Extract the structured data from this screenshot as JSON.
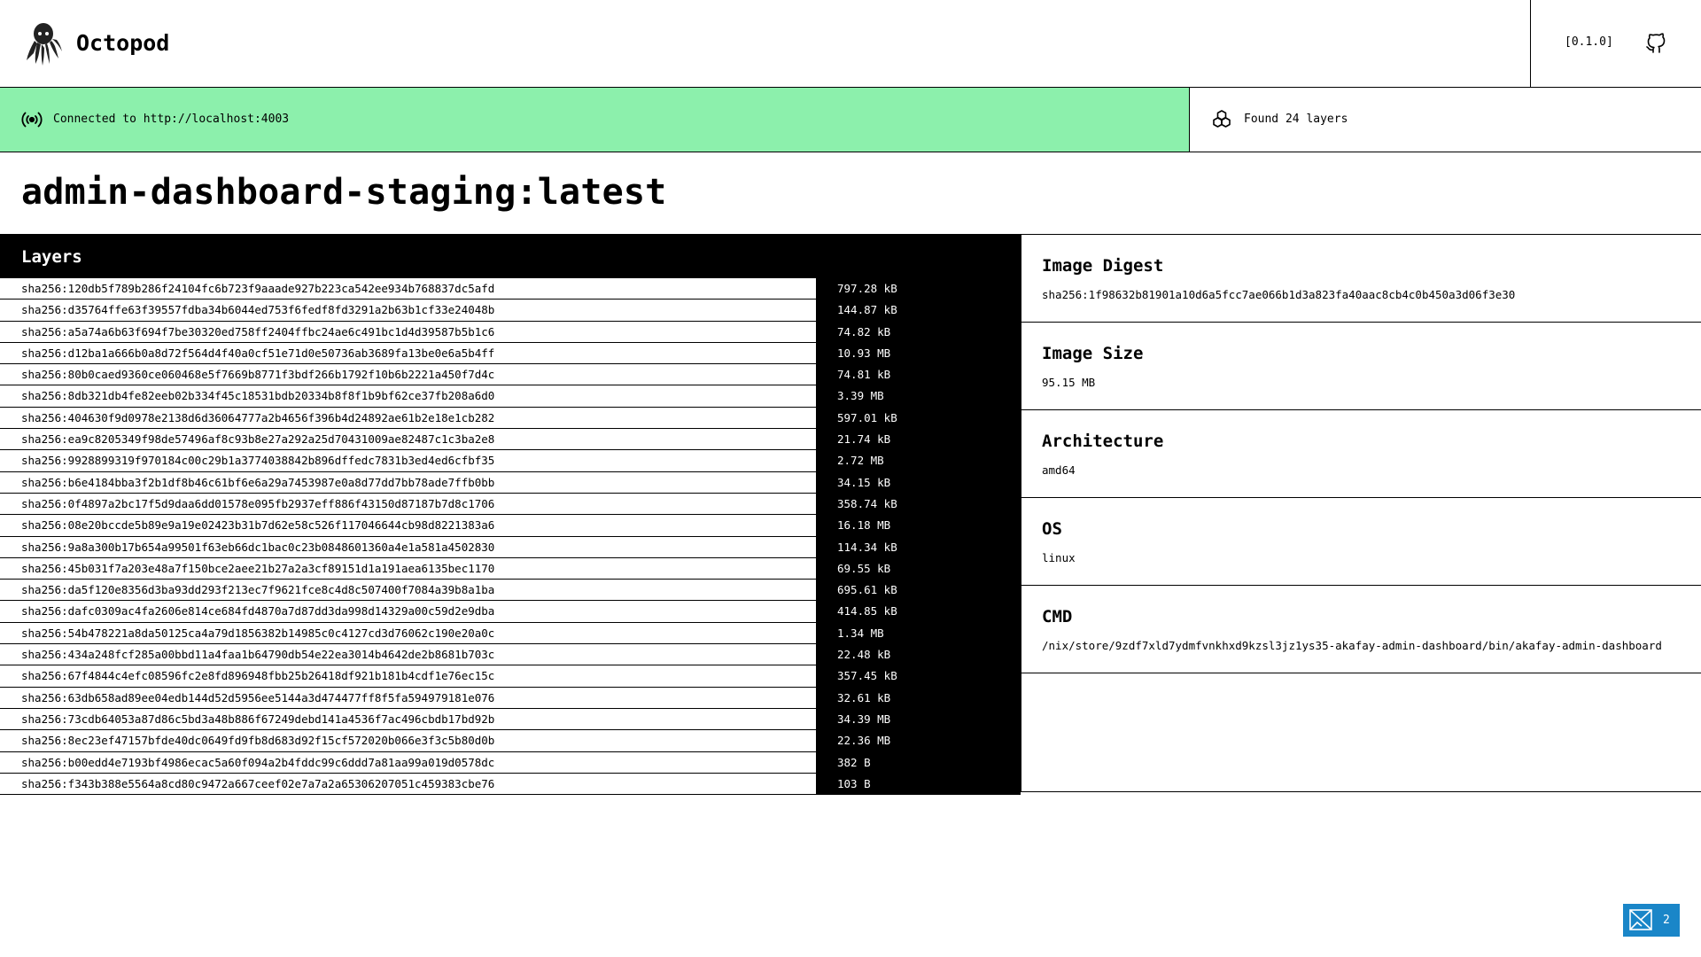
{
  "header": {
    "app_title": "Octopod",
    "version": "[0.1.0]",
    "logo_icon": "octopus-icon",
    "github_icon": "github-icon"
  },
  "status": {
    "connected_text": "Connected to http://localhost:4003",
    "found_text": "Found 24 layers",
    "connected_color": "#8cf0ac"
  },
  "image": {
    "title": "admin-dashboard-staging:latest"
  },
  "layers": {
    "heading": "Layers",
    "items": [
      {
        "hash": "sha256:120db5f789b286f24104fc6b723f9aaade927b223ca542ee934b768837dc5afd",
        "size": "797.28 kB"
      },
      {
        "hash": "sha256:d35764ffe63f39557fdba34b6044ed753f6fedf8fd3291a2b63b1cf33e24048b",
        "size": "144.87 kB"
      },
      {
        "hash": "sha256:a5a74a6b63f694f7be30320ed758ff2404ffbc24ae6c491bc1d4d39587b5b1c6",
        "size": "74.82 kB"
      },
      {
        "hash": "sha256:d12ba1a666b0a8d72f564d4f40a0cf51e71d0e50736ab3689fa13be0e6a5b4ff",
        "size": "10.93 MB"
      },
      {
        "hash": "sha256:80b0caed9360ce060468e5f7669b8771f3bdf266b1792f10b6b2221a450f7d4c",
        "size": "74.81 kB"
      },
      {
        "hash": "sha256:8db321db4fe82eeb02b334f45c18531bdb20334b8f8f1b9bf62ce37fb208a6d0",
        "size": "3.39 MB"
      },
      {
        "hash": "sha256:404630f9d0978e2138d6d36064777a2b4656f396b4d24892ae61b2e18e1cb282",
        "size": "597.01 kB"
      },
      {
        "hash": "sha256:ea9c8205349f98de57496af8c93b8e27a292a25d70431009ae82487c1c3ba2e8",
        "size": "21.74 kB"
      },
      {
        "hash": "sha256:9928899319f970184c00c29b1a3774038842b896dffedc7831b3ed4ed6cfbf35",
        "size": "2.72 MB"
      },
      {
        "hash": "sha256:b6e4184bba3f2b1df8b46c61bf6e6a29a7453987e0a8d77dd7bb78ade7ffb0bb",
        "size": "34.15 kB"
      },
      {
        "hash": "sha256:0f4897a2bc17f5d9daa6dd01578e095fb2937eff886f43150d87187b7d8c1706",
        "size": "358.74 kB"
      },
      {
        "hash": "sha256:08e20bccde5b89e9a19e02423b31b7d62e58c526f117046644cb98d8221383a6",
        "size": "16.18 MB"
      },
      {
        "hash": "sha256:9a8a300b17b654a99501f63eb66dc1bac0c23b0848601360a4e1a581a4502830",
        "size": "114.34 kB"
      },
      {
        "hash": "sha256:45b031f7a203e48a7f150bce2aee21b27a2a3cf89151d1a191aea6135bec1170",
        "size": "69.55 kB"
      },
      {
        "hash": "sha256:da5f120e8356d3ba93dd293f213ec7f9621fce8c4d8c507400f7084a39b8a1ba",
        "size": "695.61 kB"
      },
      {
        "hash": "sha256:dafc0309ac4fa2606e814ce684fd4870a7d87dd3da998d14329a00c59d2e9dba",
        "size": "414.85 kB"
      },
      {
        "hash": "sha256:54b478221a8da50125ca4a79d1856382b14985c0c4127cd3d76062c190e20a0c",
        "size": "1.34 MB"
      },
      {
        "hash": "sha256:434a248fcf285a00bbd11a4faa1b64790db54e22ea3014b4642de2b8681b703c",
        "size": "22.48 kB"
      },
      {
        "hash": "sha256:67f4844c4efc08596fc2e8fd896948fbb25b26418df921b181b4cdf1e76ec15c",
        "size": "357.45 kB"
      },
      {
        "hash": "sha256:63db658ad89ee04edb144d52d5956ee5144a3d474477ff8f5fa594979181e076",
        "size": "32.61 kB"
      },
      {
        "hash": "sha256:73cdb64053a87d86c5bd3a48b886f67249debd141a4536f7ac496cbdb17bd92b",
        "size": "34.39 MB"
      },
      {
        "hash": "sha256:8ec23ef47157bfde40dc0649fd9fb8d683d92f15cf572020b066e3f3c5b80d0b",
        "size": "22.36 MB"
      },
      {
        "hash": "sha256:b00edd4e7193bf4986ecac5a60f094a2b4fddc99c6ddd7a81aa99a019d0578dc",
        "size": "382 B"
      },
      {
        "hash": "sha256:f343b388e5564a8cd80c9472a667ceef02e7a7a2a65306207051c459383cbe76",
        "size": "103 B"
      }
    ]
  },
  "details": [
    {
      "label": "Image Digest",
      "value": "sha256:1f98632b81901a10d6a5fcc7ae066b1d3a823fa40aac8cb4c0b450a3d06f3e30"
    },
    {
      "label": "Image Size",
      "value": "95.15 MB"
    },
    {
      "label": "Architecture",
      "value": "amd64"
    },
    {
      "label": "OS",
      "value": "linux"
    },
    {
      "label": "CMD",
      "value": "/nix/store/9zdf7xld7ydmfvnkhxd9kzsl3jz1ys35-akafay-admin-dashboard/bin/akafay-admin-dashboard"
    }
  ],
  "badge": {
    "count": "2",
    "icon": "image-placeholder-icon",
    "color": "#1a86c8"
  }
}
